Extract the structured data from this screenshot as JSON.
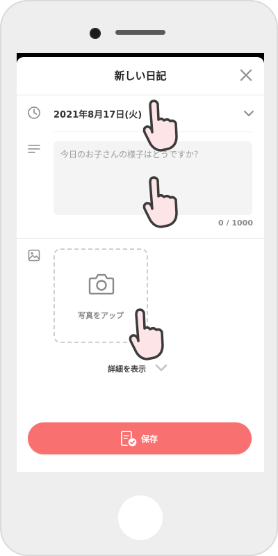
{
  "header": {
    "title": "新しい日記"
  },
  "entry": {
    "date": "2021年8月17日(火)",
    "placeholder": "今日のお子さんの様子はどうですか？",
    "counter": "0 / 1000"
  },
  "photo": {
    "upload_label": "写真をアップ"
  },
  "details": {
    "toggle_label": "詳細を表示"
  },
  "actions": {
    "save_label": "保存"
  },
  "colors": {
    "accent": "#f97070",
    "field_bg": "#f4f4f4",
    "device": "#eeeeee",
    "hand_fill": "#fde4e6"
  },
  "icons": [
    "clock-icon",
    "memo-icon",
    "image-icon",
    "camera-icon",
    "close-icon",
    "chevron-down-icon",
    "save-check-icon",
    "pointing-hand-icon"
  ]
}
